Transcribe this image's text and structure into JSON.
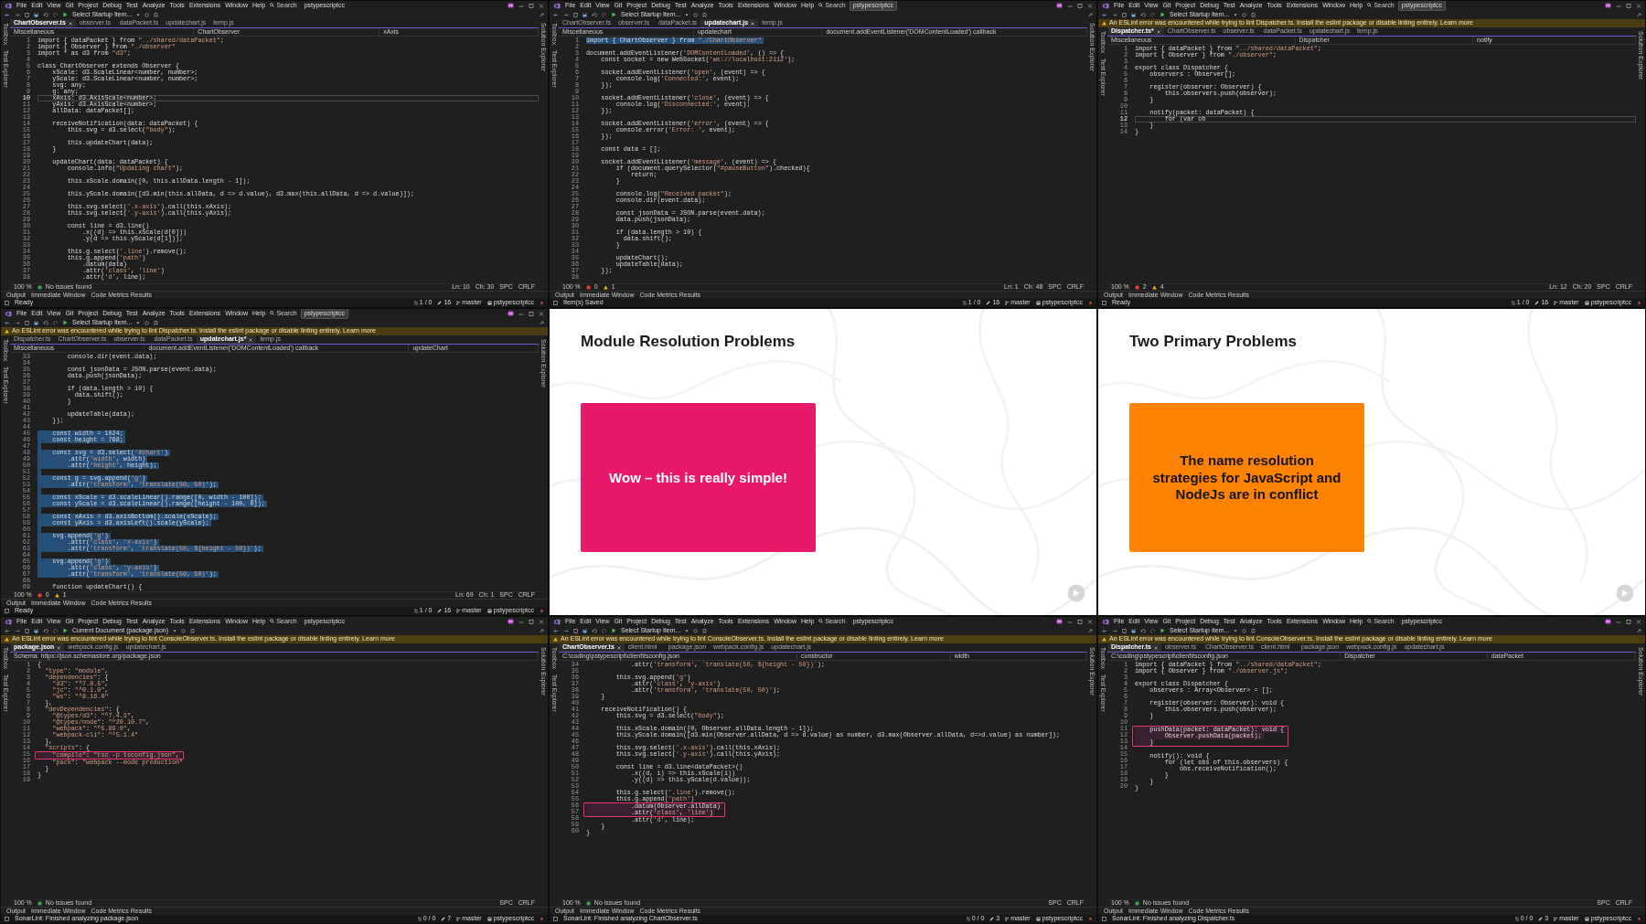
{
  "tiles": [
    {
      "kind": "ide",
      "menu": [
        "File",
        "Edit",
        "View",
        "Git",
        "Project",
        "Debug",
        "Test",
        "Analyze",
        "Tools",
        "Extensions",
        "Window",
        "Help"
      ],
      "search": "Search",
      "solution": "pstypescriptcc",
      "solution_highlighted": false,
      "startup": "Select Startup Item...",
      "left_rail": [
        "Toolbox",
        "Test Explorer"
      ],
      "right_rail": [
        "Solution Explorer"
      ],
      "tabs": [
        {
          "label": "ChartObserver.ts",
          "selected": true
        },
        {
          "label": "observer.ts",
          "selected": false
        },
        {
          "label": "dataPacket.ts",
          "selected": false
        },
        {
          "label": "updatechart.js",
          "selected": false
        },
        {
          "label": "temp.js",
          "selected": false
        }
      ],
      "nav": [
        "Miscellaneous",
        "ChartObserver",
        "xAxis"
      ],
      "lines": [
        {
          "n": "1",
          "code": "import { dataPacket } from \"../shared/dataPacket\";",
          "current": false
        },
        {
          "n": "2",
          "code": "import { Observer } from \"./observer\"",
          "current": false
        },
        {
          "n": "3",
          "code": "import * as d3 from \"d3\";",
          "current": false
        },
        {
          "n": "4",
          "current": false
        },
        {
          "n": "5",
          "code": "class ChartObserver extends Observer {",
          "current": false
        },
        {
          "n": "6",
          "code": "    xScale: d3.ScaleLinear<number, number>;",
          "current": false
        },
        {
          "n": "7",
          "code": "    yScale: d3.ScaleLinear<number, number>;",
          "current": false
        },
        {
          "n": "8",
          "code": "    svg: any;",
          "current": false
        },
        {
          "n": "9",
          "code": "    g: any;",
          "current": false
        },
        {
          "n": "10",
          "code": "    xAxis: d3.AxisScale<number>;",
          "current": true
        },
        {
          "n": "11",
          "code": "    yAxis: d3.AxisScale<number>;",
          "current": false
        },
        {
          "n": "12",
          "code": "    allData: dataPacket[];",
          "current": false
        },
        {
          "n": "13",
          "current": false
        },
        {
          "n": "14",
          "code": "    receiveNotification(data: dataPacket) {",
          "current": false
        },
        {
          "n": "15",
          "code": "        this.svg = d3.select(\"body\");",
          "current": false
        },
        {
          "n": "16",
          "current": false
        },
        {
          "n": "17",
          "code": "        this.updateChart(data);",
          "current": false
        },
        {
          "n": "18",
          "code": "    }",
          "current": false
        },
        {
          "n": "19",
          "current": false
        },
        {
          "n": "20",
          "code": "    updateChart(data: dataPacket) {",
          "current": false
        },
        {
          "n": "21",
          "code": "        console.info(\"Updating chart\");",
          "current": false
        },
        {
          "n": "22",
          "current": false
        },
        {
          "n": "23",
          "code": "        this.xScale.domain([0, this.allData.length - 1]);",
          "current": false
        },
        {
          "n": "24",
          "current": false
        },
        {
          "n": "25",
          "code": "        this.yScale.domain([d3.min(this.allData, d => d.value), d3.max(this.allData, d => d.value)]);",
          "current": false
        },
        {
          "n": "26",
          "current": false
        },
        {
          "n": "27",
          "code": "        this.svg.select('.x-axis').call(this.xAxis);",
          "current": false
        },
        {
          "n": "28",
          "code": "        this.svg.select('.y-axis').call(this.yAxis);",
          "current": false
        },
        {
          "n": "29",
          "current": false
        },
        {
          "n": "30",
          "code": "        const line = d3.line()",
          "current": false
        },
        {
          "n": "31",
          "code": "            .x((d) => this.xScale(d[0]))",
          "current": false
        },
        {
          "n": "32",
          "code": "            .y(d => this.yScale(d[1]));",
          "current": false
        },
        {
          "n": "33",
          "current": false
        },
        {
          "n": "34",
          "code": "        this.g.select('.line').remove();",
          "current": false
        },
        {
          "n": "35",
          "code": "        this.g.append('path')",
          "current": false
        },
        {
          "n": "36",
          "code": "            .datum(data)",
          "current": false
        },
        {
          "n": "37",
          "code": "            .attr('class', 'line')",
          "current": false
        },
        {
          "n": "38",
          "code": "            .attr('d', line);",
          "current": false
        }
      ],
      "strip": {
        "zoom": "100 %",
        "issues": [
          {
            "kind": "ok",
            "text": "No issues found"
          }
        ],
        "cursor": [
          "Ln: 10",
          "Ch: 30",
          "SPC",
          "CRLF"
        ]
      },
      "panels": [
        "Output",
        "Immediate Window",
        "Code Metrics Results"
      ],
      "status": {
        "message": "Ready",
        "sync": "1 / 0",
        "edits": "16",
        "branch": "master",
        "repo": "pstypescriptcc"
      }
    },
    {
      "kind": "ide",
      "menu": [
        "File",
        "Edit",
        "View",
        "Git",
        "Project",
        "Debug",
        "Test",
        "Analyze",
        "Tools",
        "Extensions",
        "Window",
        "Help"
      ],
      "search": "Search",
      "solution": "pstypescriptcc",
      "solution_highlighted": true,
      "startup": "Select Startup Item...",
      "left_rail": [
        "Toolbox",
        "Test Explorer"
      ],
      "right_rail": [
        "Solution Explorer"
      ],
      "tabs": [
        {
          "label": "ChartObserver.ts",
          "selected": false
        },
        {
          "label": "observer.ts",
          "selected": false
        },
        {
          "label": "dataPacket.ts",
          "selected": false
        },
        {
          "label": "updatechart.js",
          "selected": true
        },
        {
          "label": "temp.js",
          "selected": false
        }
      ],
      "nav": [
        "Miscellaneous",
        "updatechart",
        "document.addEventListener('DOMContentLoaded') callback"
      ],
      "lines": [
        {
          "n": "1",
          "code": "import { ChartObserver } from \"./ChartObserver\"",
          "selected": true
        },
        {
          "n": "2",
          "selected": false
        },
        {
          "n": "3",
          "code": "document.addEventListener('DOMContentLoaded', () => {",
          "selected": false
        },
        {
          "n": "4",
          "code": "    const socket = new WebSocket('ws://localhost:2112');",
          "selected": false
        },
        {
          "n": "5",
          "selected": false
        },
        {
          "n": "6",
          "code": "    socket.addEventListener('open', (event) => {",
          "selected": false
        },
        {
          "n": "7",
          "code": "        console.log('Connected:', event);",
          "selected": false
        },
        {
          "n": "8",
          "code": "    });",
          "selected": false
        },
        {
          "n": "9",
          "selected": false
        },
        {
          "n": "10",
          "code": "    socket.addEventListener('close', (event) => {",
          "selected": false
        },
        {
          "n": "11",
          "code": "        console.log('Disconnected:', event);",
          "selected": false
        },
        {
          "n": "12",
          "code": "    });",
          "selected": false
        },
        {
          "n": "13",
          "selected": false
        },
        {
          "n": "14",
          "code": "    socket.addEventListener('error', (event) => {",
          "selected": false
        },
        {
          "n": "15",
          "code": "        console.error('Error: ', event);",
          "selected": false
        },
        {
          "n": "16",
          "code": "    });",
          "selected": false
        },
        {
          "n": "17",
          "selected": false
        },
        {
          "n": "18",
          "code": "    const data = [];",
          "selected": false
        },
        {
          "n": "19",
          "selected": false
        },
        {
          "n": "20",
          "code": "    socket.addEventListener('message', (event) => {",
          "selected": false
        },
        {
          "n": "21",
          "code": "        if (document.querySelector(\"#pauseButton\").checked){",
          "selected": false
        },
        {
          "n": "22",
          "code": "            return;",
          "selected": false
        },
        {
          "n": "23",
          "code": "        }",
          "selected": false
        },
        {
          "n": "24",
          "selected": false
        },
        {
          "n": "25",
          "code": "        console.log(\"Received packet\");",
          "selected": false
        },
        {
          "n": "26",
          "code": "        console.dir(event.data);",
          "selected": false
        },
        {
          "n": "27",
          "selected": false
        },
        {
          "n": "28",
          "code": "        const jsonData = JSON.parse(event.data);",
          "selected": false
        },
        {
          "n": "29",
          "code": "        data.push(jsonData);",
          "selected": false
        },
        {
          "n": "30",
          "selected": false
        },
        {
          "n": "31",
          "code": "        if (data.length > 10) {",
          "selected": false
        },
        {
          "n": "32",
          "code": "          data.shift();",
          "selected": false
        },
        {
          "n": "33",
          "code": "        }",
          "selected": false
        },
        {
          "n": "34",
          "selected": false
        },
        {
          "n": "35",
          "code": "        updateChart();",
          "selected": false
        },
        {
          "n": "36",
          "code": "        updateTable(data);",
          "selected": false
        },
        {
          "n": "37",
          "code": "    });",
          "selected": false
        },
        {
          "n": "38",
          "selected": false
        }
      ],
      "strip": {
        "zoom": "100 %",
        "issues": [
          {
            "kind": "error",
            "text": "0"
          },
          {
            "kind": "warning",
            "text": "1"
          }
        ],
        "cursor": [
          "Ln: 1",
          "Ch: 48",
          "SPC",
          "CRLF"
        ]
      },
      "panels": [
        "Output",
        "Immediate Window",
        "Code Metrics Results"
      ],
      "status": {
        "message": "Item(s) Saved",
        "sync": "1 / 0",
        "edits": "16",
        "branch": "master",
        "repo": "pstypescriptcc"
      }
    },
    {
      "kind": "ide",
      "menu": [
        "File",
        "Edit",
        "View",
        "Git",
        "Project",
        "Debug",
        "Test",
        "Analyze",
        "Tools",
        "Extensions",
        "Window",
        "Help"
      ],
      "search": "Search",
      "solution": "pstypescriptcc",
      "solution_highlighted": true,
      "startup": "Select Startup Item...",
      "infobar": "An ESLint error was encountered while trying to lint Dispatcher.ts. Install the eslint package or disable linting entirely. Learn more",
      "left_rail": [
        "Toolbox",
        "Test Explorer"
      ],
      "right_rail": [
        "Solution Explorer"
      ],
      "tabs": [
        {
          "label": "Dispatcher.ts*",
          "selected": true
        },
        {
          "label": "ChartObserver.ts",
          "selected": false
        },
        {
          "label": "observer.ts",
          "selected": false
        },
        {
          "label": "dataPacket.ts",
          "selected": false
        },
        {
          "label": "updatechart.js",
          "selected": false
        },
        {
          "label": "temp.js",
          "selected": false
        }
      ],
      "nav": [
        "Miscellaneous",
        "Dispatcher",
        "notify"
      ],
      "lines": [
        {
          "n": "1",
          "code": "import { dataPacket } from \"../shared/dataPacket\";",
          "current": false
        },
        {
          "n": "2",
          "code": "import { Observer } from \"./observer\";",
          "current": false
        },
        {
          "n": "3",
          "current": false
        },
        {
          "n": "4",
          "code": "export class Dispatcher {",
          "current": false
        },
        {
          "n": "5",
          "code": "    observers : Observer[];",
          "current": false
        },
        {
          "n": "6",
          "current": false
        },
        {
          "n": "7",
          "code": "    register(observer: Observer) {",
          "current": false
        },
        {
          "n": "8",
          "code": "        this.observers.push(observer);",
          "current": false
        },
        {
          "n": "9",
          "code": "    }",
          "current": false
        },
        {
          "n": "10",
          "current": false
        },
        {
          "n": "11",
          "code": "    notify(packet: dataPacket) {",
          "current": false
        },
        {
          "n": "12",
          "code": "        for (var ob",
          "current": true
        },
        {
          "n": "13",
          "code": "    }",
          "current": false
        },
        {
          "n": "14",
          "code": "}",
          "current": false
        }
      ],
      "strip": {
        "zoom": "100 %",
        "issues": [
          {
            "kind": "error",
            "text": "2"
          },
          {
            "kind": "warning",
            "text": "4"
          }
        ],
        "cursor": [
          "Ln: 12",
          "Ch: 20",
          "SPC",
          "CRLF"
        ]
      },
      "panels": [
        "Output",
        "Immediate Window",
        "Code Metrics Results"
      ],
      "status": {
        "message": "Ready",
        "sync": "1 / 0",
        "edits": "16",
        "branch": "master",
        "repo": "pstypescriptcc"
      }
    },
    {
      "kind": "ide",
      "menu": [
        "File",
        "Edit",
        "View",
        "Git",
        "Project",
        "Debug",
        "Test",
        "Analyze",
        "Tools",
        "Extensions",
        "Window",
        "Help"
      ],
      "search": "Search",
      "solution": "pstypescriptcc",
      "solution_highlighted": true,
      "startup": "Select Startup Item...",
      "infobar": "An ESLint error was encountered while trying to lint Dispatcher.ts. Install the eslint package or disable linting entirely. Learn more",
      "left_rail": [
        "Toolbox",
        "Test Explorer"
      ],
      "right_rail": [
        "Solution Explorer"
      ],
      "tabs": [
        {
          "label": "Dispatcher.ts",
          "selected": false
        },
        {
          "label": "ChartObserver.ts",
          "selected": false
        },
        {
          "label": "observer.ts",
          "selected": false
        },
        {
          "label": "dataPacket.ts",
          "selected": false
        },
        {
          "label": "updatechart.js*",
          "selected": true
        },
        {
          "label": "temp.js",
          "selected": false
        }
      ],
      "nav": [
        "Miscellaneous",
        "document.addEventListener('DOMContentLoaded') callback",
        "updateChart"
      ],
      "lines": [
        {
          "n": "33",
          "code": "        console.dir(event.data);",
          "selected": false
        },
        {
          "n": "34",
          "selected": false
        },
        {
          "n": "35",
          "code": "        const jsonData = JSON.parse(event.data);",
          "selected": false
        },
        {
          "n": "36",
          "code": "        data.push(jsonData);",
          "selected": false
        },
        {
          "n": "37",
          "selected": false
        },
        {
          "n": "38",
          "code": "        if (data.length > 10) {",
          "selected": false
        },
        {
          "n": "39",
          "code": "          data.shift();",
          "selected": false
        },
        {
          "n": "40",
          "code": "        }",
          "selected": false
        },
        {
          "n": "41",
          "selected": false
        },
        {
          "n": "42",
          "code": "        updateTable(data);",
          "selected": false
        },
        {
          "n": "43",
          "code": "    });",
          "selected": false
        },
        {
          "n": "44",
          "selected": false
        },
        {
          "n": "45",
          "code": "    const width = 1024;",
          "selected": true
        },
        {
          "n": "46",
          "code": "    const height = 768;",
          "selected": true
        },
        {
          "n": "47",
          "selected": true
        },
        {
          "n": "48",
          "code": "    const svg = d3.select('#chart')",
          "selected": true
        },
        {
          "n": "49",
          "code": "        .attr('width', width)",
          "selected": true
        },
        {
          "n": "50",
          "code": "        .attr('height', height);",
          "selected": true
        },
        {
          "n": "51",
          "selected": true
        },
        {
          "n": "52",
          "code": "    const g = svg.append('g')",
          "selected": true
        },
        {
          "n": "53",
          "code": "        .attr('transform', 'translate(50, 50)');",
          "selected": true
        },
        {
          "n": "54",
          "selected": true
        },
        {
          "n": "55",
          "code": "    const xScale = d3.scaleLinear().range([0, width - 100]);",
          "selected": true
        },
        {
          "n": "56",
          "code": "    const yScale = d3.scaleLinear().range([height - 100, 0]);",
          "selected": true
        },
        {
          "n": "57",
          "selected": true
        },
        {
          "n": "58",
          "code": "    const xAxis = d3.axisBottom().scale(xScale);",
          "selected": true
        },
        {
          "n": "59",
          "code": "    const yAxis = d3.axisLeft().scale(yScale);",
          "selected": true
        },
        {
          "n": "60",
          "selected": true
        },
        {
          "n": "61",
          "code": "    svg.append('g')",
          "selected": true
        },
        {
          "n": "62",
          "code": "        .attr('class', 'x-axis')",
          "selected": true
        },
        {
          "n": "63",
          "code": "        .attr('transform', `translate(50, ${height - 50})`);",
          "selected": true
        },
        {
          "n": "64",
          "selected": true
        },
        {
          "n": "65",
          "code": "    svg.append('g')",
          "selected": true
        },
        {
          "n": "66",
          "code": "        .attr('class', 'y-axis')",
          "selected": true
        },
        {
          "n": "67",
          "code": "        .attr('transform', 'translate(50, 50)');",
          "selected": true
        },
        {
          "n": "68",
          "selected": false
        },
        {
          "n": "69",
          "code": "    function updateChart() {",
          "selected": false
        }
      ],
      "strip": {
        "zoom": "100 %",
        "issues": [
          {
            "kind": "error",
            "text": "0"
          },
          {
            "kind": "warning",
            "text": "1"
          }
        ],
        "cursor": [
          "Ln: 69",
          "Ch: 1",
          "SPC",
          "CRLF"
        ]
      },
      "panels": [
        "Output",
        "Immediate Window",
        "Code Metrics Results"
      ],
      "status": {
        "message": "Ready",
        "sync": "1 / 0",
        "edits": "16",
        "branch": "master",
        "repo": "pstypescriptcc"
      }
    },
    {
      "kind": "slide",
      "title": "Module Resolution Problems",
      "card_text": "Wow – this is really simple!",
      "color": "#e8196a"
    },
    {
      "kind": "slide",
      "title": "Two Primary Problems",
      "card_text": "The name resolution strategies for JavaScript and NodeJs are in conflict",
      "color": "#ff8200"
    },
    {
      "kind": "ide",
      "menu": [
        "File",
        "Edit",
        "View",
        "Git",
        "Project",
        "Debug",
        "Test",
        "Analyze",
        "Tools",
        "Extensions",
        "Window",
        "Help"
      ],
      "search": "Search",
      "solution": "pstypescriptcc",
      "solution_highlighted": false,
      "startup": "Current Document (package.json)",
      "infobar": "An ESLint error was encountered while trying to lint ConsoleObserver.ts. Install the eslint package or disable linting entirely. Learn more",
      "left_rail": [
        "Toolbox",
        "Test Explorer"
      ],
      "right_rail": [
        "Solution Explorer"
      ],
      "tabs": [
        {
          "label": "package.json",
          "selected": true
        },
        {
          "label": "webpack.config.js",
          "selected": false
        },
        {
          "label": "updatechart.js",
          "selected": false
        }
      ],
      "nav": [
        "Schema: https://json.schemastore.org/package.json"
      ],
      "lines": [
        {
          "n": "1",
          "code": "{",
          "boxed": false
        },
        {
          "n": "2",
          "code": "  \"type\": \"module\",",
          "boxed": false
        },
        {
          "n": "3",
          "code": "  \"dependencies\": {",
          "boxed": false
        },
        {
          "n": "4",
          "code": "    \"d3\": \"^7.8.5\",",
          "boxed": false
        },
        {
          "n": "5",
          "code": "    \"jc\": \"^0.1.0\",",
          "boxed": false
        },
        {
          "n": "6",
          "code": "    \"ws\": \"^8.16.0\"",
          "boxed": false
        },
        {
          "n": "7",
          "code": "  },",
          "boxed": false
        },
        {
          "n": "8",
          "code": "  \"devDependencies\": {",
          "boxed": false
        },
        {
          "n": "9",
          "code": "    \"@types/d3\": \"^7.4.3\",",
          "boxed": false
        },
        {
          "n": "10",
          "code": "    \"@types/node\": \"^20.10.7\",",
          "boxed": false
        },
        {
          "n": "11",
          "code": "    \"webpack\": \"^5.89.0\",",
          "boxed": false
        },
        {
          "n": "12",
          "code": "    \"webpack-cli\": \"^5.1.4\"",
          "boxed": false
        },
        {
          "n": "13",
          "code": "  },",
          "boxed": false
        },
        {
          "n": "14",
          "code": "  \"scripts\": {",
          "boxed": false
        },
        {
          "n": "15",
          "code": "    \"compile\": \"tsc -p tsconfig.json\",",
          "boxed": true
        },
        {
          "n": "16",
          "code": "    \"pack\": \"webpack --mode production\"",
          "boxed": false
        },
        {
          "n": "17",
          "code": "  }",
          "boxed": false
        },
        {
          "n": "18",
          "code": "}",
          "boxed": false
        },
        {
          "n": "19",
          "boxed": false
        }
      ],
      "strip": {
        "zoom": "100 %",
        "issues": [
          {
            "kind": "ok",
            "text": "No issues found"
          }
        ],
        "cursor": [
          "SPC",
          "CRLF"
        ]
      },
      "panels": [
        "Output",
        "Immediate Window",
        "Code Metrics Results"
      ],
      "status": {
        "message": "SonarLint: Finished analyzing package.json",
        "sync": "0 / 0",
        "edits": "7",
        "branch": "master",
        "repo": "pstypescriptcc"
      }
    },
    {
      "kind": "ide",
      "menu": [
        "File",
        "Edit",
        "View",
        "Git",
        "Project",
        "Debug",
        "Test",
        "Analyze",
        "Tools",
        "Extensions",
        "Window",
        "Help"
      ],
      "search": "Search",
      "solution": "pstypescriptcc",
      "solution_highlighted": false,
      "startup": "Select Startup Item...",
      "infobar": "An ESLint error was encountered while trying to lint ConsoleObserver.ts. Install the eslint package or disable linting entirely. Learn more",
      "left_rail": [
        "Toolbox",
        "Test Explorer"
      ],
      "right_rail": [
        "Solution Explorer"
      ],
      "tabs": [
        {
          "label": "ChartObserver.ts",
          "selected": true
        },
        {
          "label": "client.html",
          "selected": false
        },
        {
          "label": "package.json",
          "selected": false
        },
        {
          "label": "webpack.config.js",
          "selected": false
        },
        {
          "label": "updatechart.js",
          "selected": false
        }
      ],
      "nav": [
        "C:\\coding\\pstypescript\\client\\tsconfig.json",
        "constructor",
        "width"
      ],
      "lines": [
        {
          "n": "34",
          "code": "            .attr('transform', `translate(50, ${height - 50})`);",
          "boxed": false
        },
        {
          "n": "35",
          "boxed": false
        },
        {
          "n": "36",
          "code": "        this.svg.append('g')",
          "boxed": false
        },
        {
          "n": "37",
          "code": "            .attr('class', 'y-axis')",
          "boxed": false
        },
        {
          "n": "38",
          "code": "            .attr('transform', 'translate(50, 50)');",
          "boxed": false
        },
        {
          "n": "39",
          "code": "    }",
          "boxed": false
        },
        {
          "n": "40",
          "boxed": false
        },
        {
          "n": "41",
          "code": "    receiveNotification() {",
          "boxed": false
        },
        {
          "n": "42",
          "code": "        this.svg = d3.select(\"body\");",
          "boxed": false
        },
        {
          "n": "43",
          "boxed": false
        },
        {
          "n": "44",
          "code": "        this.xScale.domain([0, Observer.allData.length - 1]);",
          "boxed": false
        },
        {
          "n": "45",
          "code": "        this.yScale.domain([d3.min(Observer.allData, d => d.value) as number, d3.max(Observer.allData, d=>d.value) as number]);",
          "boxed": false
        },
        {
          "n": "46",
          "boxed": false
        },
        {
          "n": "47",
          "code": "        this.svg.select('.x-axis').call(this.xAxis);",
          "boxed": false
        },
        {
          "n": "48",
          "code": "        this.svg.select('.y-axis').call(this.yAxis);",
          "boxed": false
        },
        {
          "n": "49",
          "boxed": false
        },
        {
          "n": "50",
          "code": "        const line = d3.line<dataPacket>()",
          "boxed": false
        },
        {
          "n": "51",
          "code": "            .x((d, i) => this.xScale(i))",
          "boxed": false
        },
        {
          "n": "52",
          "code": "            .y((d) => this.yScale(d.value));",
          "boxed": false
        },
        {
          "n": "53",
          "boxed": false
        },
        {
          "n": "54",
          "code": "        this.g.select('.line').remove();",
          "boxed": false
        },
        {
          "n": "55",
          "code": "        this.g.append('path')",
          "boxed": false
        },
        {
          "n": "56",
          "code": "            .datum(Observer.allData)",
          "boxed": true
        },
        {
          "n": "57",
          "code": "            .attr('class', 'line')",
          "boxed": true
        },
        {
          "n": "58",
          "code": "            .attr('d', line);",
          "boxed": false
        },
        {
          "n": "59",
          "code": "    }",
          "boxed": false
        },
        {
          "n": "60",
          "code": "}",
          "boxed": false
        }
      ],
      "strip": {
        "zoom": "100 %",
        "issues": [
          {
            "kind": "ok",
            "text": "No issues found"
          }
        ],
        "cursor": [
          "SPC",
          "CRLF"
        ]
      },
      "panels": [
        "Output",
        "Immediate Window",
        "Code Metrics Results"
      ],
      "status": {
        "message": "SonarLint: Finished analyzing ChartObserver.ts",
        "sync": "0 / 0",
        "edits": "3",
        "branch": "master",
        "repo": "pstypescriptcc"
      }
    },
    {
      "kind": "ide",
      "menu": [
        "File",
        "Edit",
        "View",
        "Git",
        "Project",
        "Debug",
        "Test",
        "Analyze",
        "Tools",
        "Extensions",
        "Window",
        "Help"
      ],
      "search": "Search",
      "solution": "pstypescriptcc",
      "solution_highlighted": false,
      "startup": "Select Startup Item...",
      "infobar": "An ESLint error was encountered while trying to lint ConsoleObserver.ts. Install the eslint package or disable linting entirely. Learn more",
      "left_rail": [
        "Toolbox",
        "Test Explorer"
      ],
      "right_rail": [
        "Solution Explorer"
      ],
      "tabs": [
        {
          "label": "Dispatcher.ts",
          "selected": true
        },
        {
          "label": "observer.ts",
          "selected": false
        },
        {
          "label": "ChartObserver.ts",
          "selected": false
        },
        {
          "label": "client.html",
          "selected": false
        },
        {
          "label": "package.json",
          "selected": false
        },
        {
          "label": "webpack.config.js",
          "selected": false
        },
        {
          "label": "updatechart.js",
          "selected": false
        }
      ],
      "nav": [
        "C:\\coding\\pstypescript\\client\\tsconfig.json",
        "Dispatcher",
        "dataPacket"
      ],
      "lines": [
        {
          "n": "1",
          "code": "import { dataPacket } from \"../shared/dataPacket\";",
          "boxed": false
        },
        {
          "n": "2",
          "code": "import { Observer } from \"./observer.js\";",
          "boxed": false
        },
        {
          "n": "3",
          "boxed": false
        },
        {
          "n": "4",
          "code": "export class Dispatcher {",
          "boxed": false
        },
        {
          "n": "5",
          "code": "    observers : Array<Observer> = [];",
          "boxed": false
        },
        {
          "n": "6",
          "boxed": false
        },
        {
          "n": "7",
          "code": "    register(observer: Observer): void {",
          "boxed": false
        },
        {
          "n": "8",
          "code": "        this.observers.push(observer);",
          "boxed": false
        },
        {
          "n": "9",
          "code": "    }",
          "boxed": false
        },
        {
          "n": "10",
          "boxed": false
        },
        {
          "n": "11",
          "code": "    pushData(packet: dataPacket): void {",
          "boxed": true
        },
        {
          "n": "12",
          "code": "        Observer.pushData(packet);",
          "boxed": true
        },
        {
          "n": "13",
          "code": "    }",
          "boxed": true
        },
        {
          "n": "14",
          "boxed": false
        },
        {
          "n": "15",
          "code": "    notify(): void {",
          "boxed": false
        },
        {
          "n": "16",
          "code": "        for (let obs of this.observers) {",
          "boxed": false
        },
        {
          "n": "17",
          "code": "            obs.receiveNotification();",
          "boxed": false
        },
        {
          "n": "18",
          "code": "        }",
          "boxed": false
        },
        {
          "n": "19",
          "code": "    }",
          "boxed": false
        },
        {
          "n": "20",
          "code": "}",
          "boxed": false
        }
      ],
      "strip": {
        "zoom": "100 %",
        "issues": [
          {
            "kind": "ok",
            "text": "No issues found"
          }
        ],
        "cursor": [
          "SPC",
          "CRLF"
        ]
      },
      "panels": [
        "Output",
        "Immediate Window",
        "Code Metrics Results"
      ],
      "status": {
        "message": "SonarLint: Finished analyzing Dispatcher.ts",
        "sync": "0 / 0",
        "edits": "3",
        "branch": "master",
        "repo": "pstypescriptcc"
      }
    }
  ]
}
